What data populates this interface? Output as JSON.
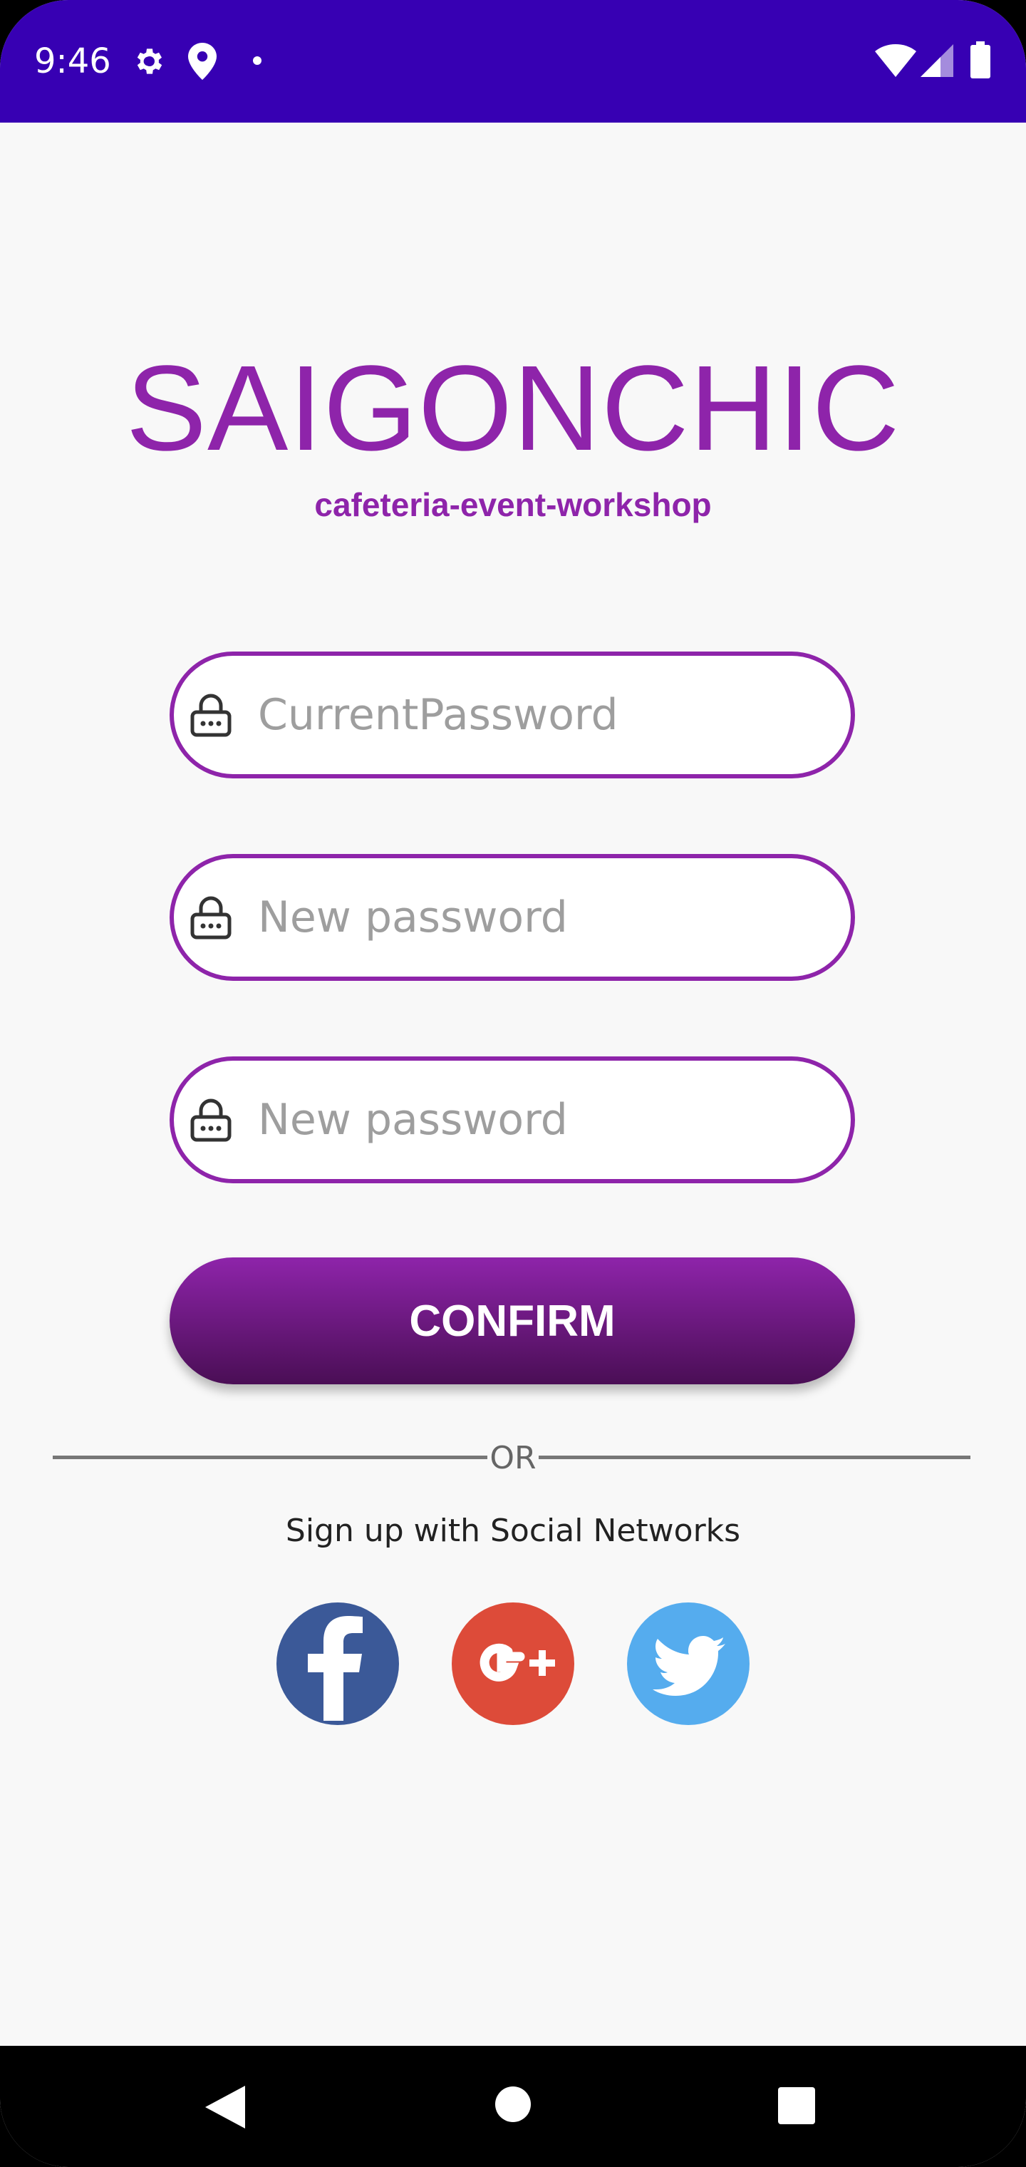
{
  "status_bar": {
    "time": "9:46",
    "icons": [
      "gear-icon",
      "location-pin-icon",
      "dot-icon",
      "wifi-icon",
      "signal-icon",
      "battery-icon"
    ],
    "background_color": "#3700b3"
  },
  "brand": {
    "title": "SAIGONCHIC",
    "subtitle": "cafeteria-event-workshop",
    "color": "#8e24aa"
  },
  "form": {
    "current_password": {
      "placeholder": "CurrentPassword",
      "value": "",
      "icon": "lock-icon"
    },
    "new_password": {
      "placeholder": "New password",
      "value": "",
      "icon": "lock-icon"
    },
    "confirm_new_password": {
      "placeholder": "New password",
      "value": "",
      "icon": "lock-icon"
    },
    "confirm_button_label": "CONFIRM"
  },
  "divider": {
    "label": "OR"
  },
  "social": {
    "prompt": "Sign up with Social Networks",
    "networks": [
      {
        "name": "facebook-icon",
        "color": "#3b5998"
      },
      {
        "name": "google-plus-icon",
        "color": "#dd4b39"
      },
      {
        "name": "twitter-icon",
        "color": "#55acee"
      }
    ]
  },
  "nav_bar": {
    "buttons": [
      "back-triangle-icon",
      "home-circle-icon",
      "recents-square-icon"
    ]
  }
}
